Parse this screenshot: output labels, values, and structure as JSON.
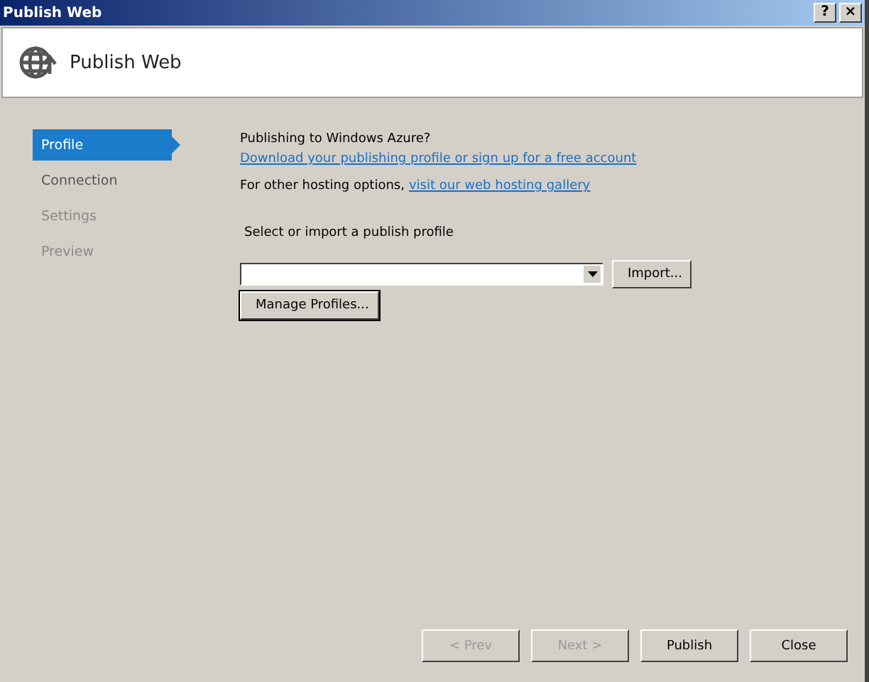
{
  "window": {
    "title": "Publish Web",
    "buttons": [
      "?",
      "×"
    ]
  },
  "header": {
    "title": "Publish Web"
  },
  "sidebar": {
    "items": [
      {
        "label": "Profile",
        "selected": true,
        "disabled": false
      },
      {
        "label": "Connection",
        "selected": false,
        "disabled": false
      },
      {
        "label": "Settings",
        "selected": false,
        "disabled": true
      },
      {
        "label": "Preview",
        "selected": false,
        "disabled": true
      }
    ]
  },
  "content": {
    "azure_heading": "Publishing to Windows Azure?",
    "azure_link": "Download your publishing profile or sign up for a free account",
    "hosting_text": "For other hosting options,",
    "hosting_link": "visit our web hosting gallery",
    "profile_label": "Select or import a publish profile",
    "import_button": "Import...",
    "manage_button": "Manage Profiles..."
  },
  "footer": {
    "buttons": [
      {
        "label": "< Prev",
        "disabled": true
      },
      {
        "label": "Next >",
        "disabled": true
      },
      {
        "label": "Publish",
        "disabled": false
      },
      {
        "label": "Close",
        "disabled": false
      }
    ]
  }
}
